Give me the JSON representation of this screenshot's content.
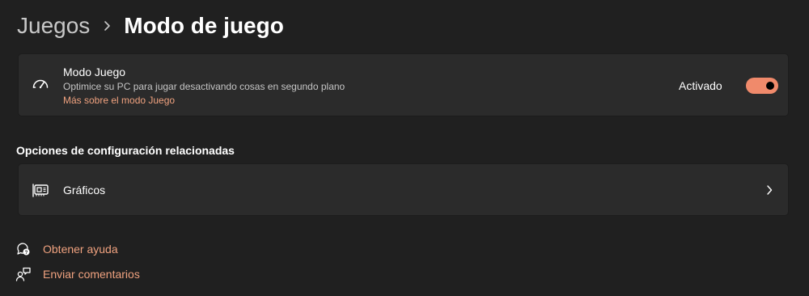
{
  "breadcrumb": {
    "parent": "Juegos",
    "separator_icon": "chevron-right-icon",
    "current": "Modo de juego"
  },
  "game_mode": {
    "icon": "gauge-icon",
    "title": "Modo Juego",
    "description": "Optimice su PC para jugar desactivando cosas en segundo plano",
    "link": "Más sobre el modo Juego",
    "status": "Activado",
    "toggle_on": true
  },
  "related": {
    "heading": "Opciones de configuración relacionadas",
    "items": [
      {
        "icon": "graphics-card-icon",
        "label": "Gráficos",
        "action_icon": "chevron-right-icon"
      }
    ]
  },
  "footer": {
    "help": {
      "icon": "help-icon",
      "label": "Obtener ayuda"
    },
    "feedback": {
      "icon": "feedback-icon",
      "label": "Enviar comentarios"
    }
  },
  "colors": {
    "background": "#202020",
    "card": "#2b2b2b",
    "accent": "#f08a6b",
    "link": "#f0a27f"
  }
}
